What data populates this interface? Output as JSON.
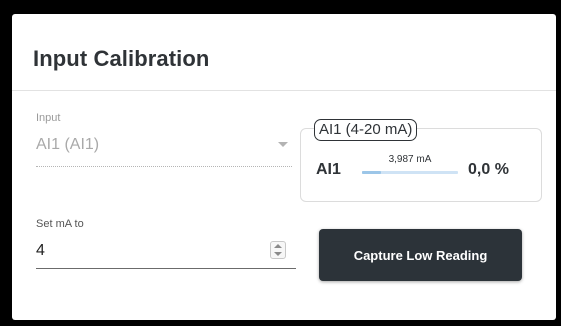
{
  "card": {
    "title": "Input Calibration"
  },
  "input": {
    "label": "Input",
    "selected": "AI1 (AI1)"
  },
  "channel": {
    "legend": "AI1 (4-20 mA)",
    "name": "AI1",
    "ma_reading": "3,987 mA",
    "ma_fraction": 0.2,
    "percent": "0,0 %"
  },
  "set_ma": {
    "label": "Set mA to",
    "value": "4"
  },
  "actions": {
    "capture_label": "Capture Low Reading"
  },
  "colors": {
    "button_bg": "#2c3339",
    "bar_track": "#cfe3f5",
    "bar_fill": "#9cc6e8",
    "text_dark": "#2f3337"
  },
  "icons": {
    "dropdown": "chevron-down-icon",
    "spinner": "spinner-arrows-icon"
  }
}
